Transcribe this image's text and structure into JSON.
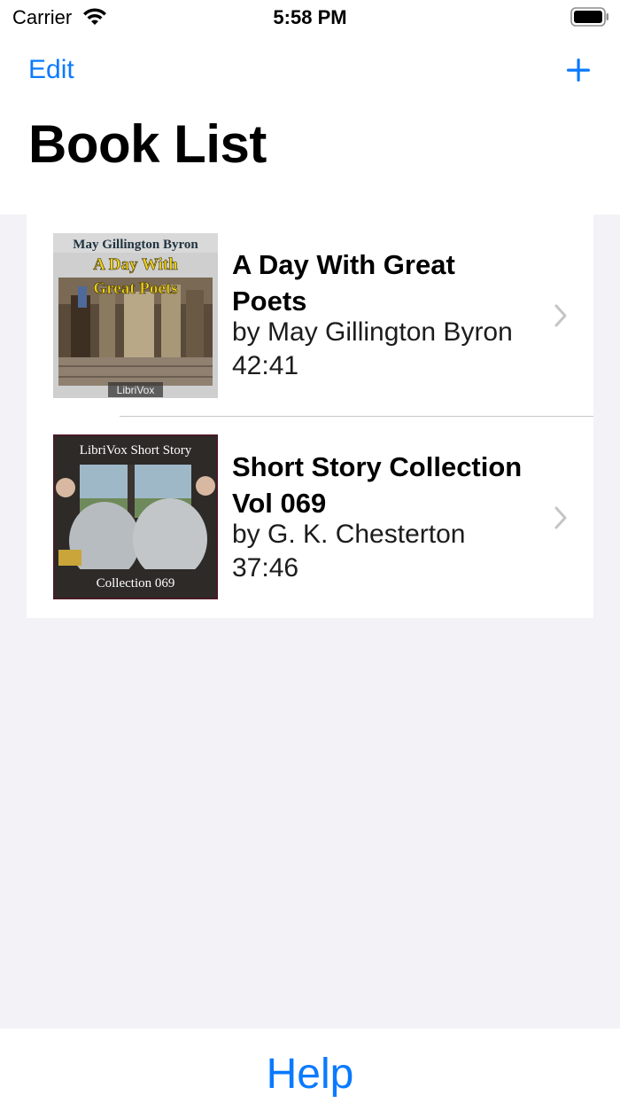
{
  "status_bar": {
    "carrier": "Carrier",
    "time": "5:58 PM",
    "wifi_icon": "wifi-icon",
    "battery_icon": "battery-icon"
  },
  "nav": {
    "edit_label": "Edit",
    "add_icon": "plus-icon",
    "title": "Book List"
  },
  "books": [
    {
      "title": "A Day With Great Poets",
      "author": "by May Gillington Byron",
      "duration": "42:41",
      "cover": {
        "top_text": "May Gillington Byron",
        "title_line1": "A Day With",
        "title_line2": "Great Poets",
        "badge": "LibriVox"
      }
    },
    {
      "title": "Short Story Collection Vol 069",
      "author": "by G. K. Chesterton",
      "duration": "37:46",
      "cover": {
        "top_text": "LibriVox Short Story",
        "bottom_text": "Collection 069"
      }
    }
  ],
  "footer": {
    "help_label": "Help"
  },
  "colors": {
    "accent": "#0a7aff",
    "background": "#f2f2f7",
    "separator": "#c6c6c8",
    "chevron": "#c4c4c7"
  }
}
